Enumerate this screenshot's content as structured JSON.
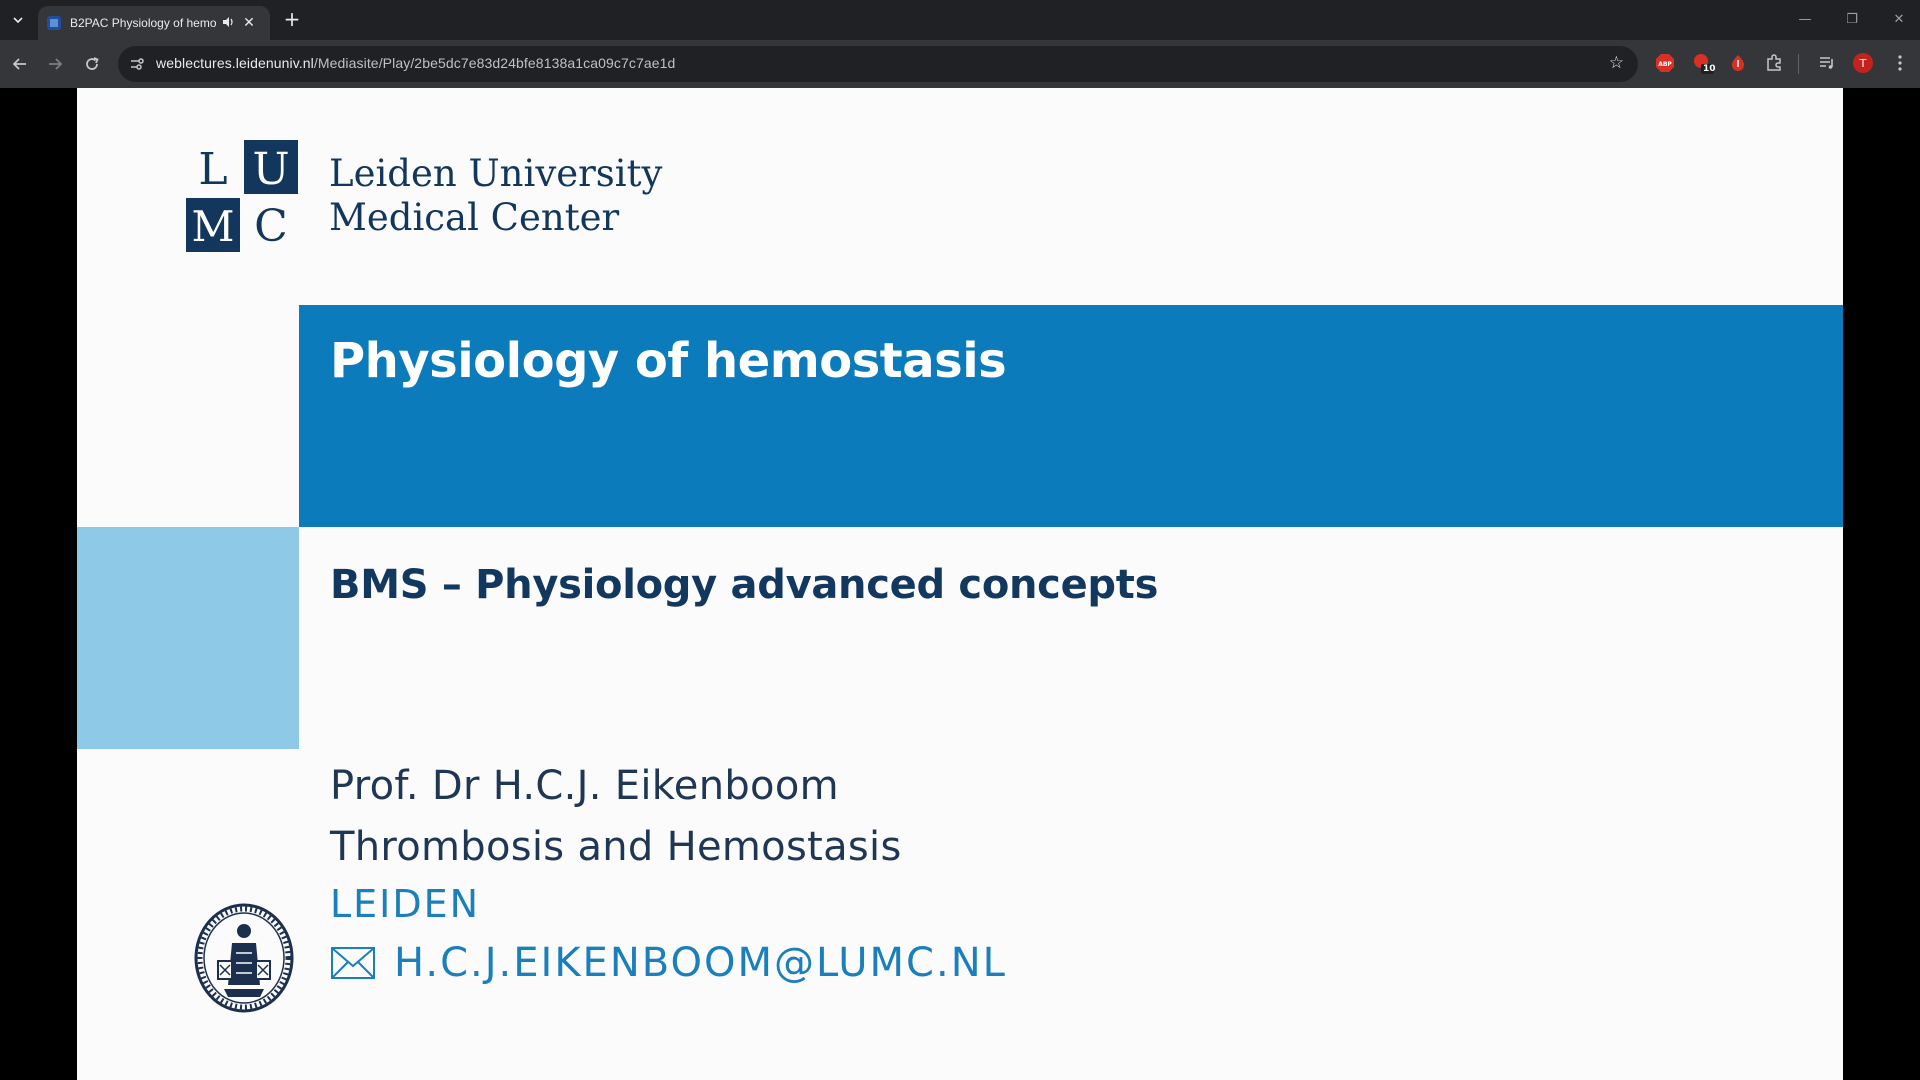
{
  "browser": {
    "tab_title": "B2PAC Physiology of hemo",
    "url_host": "weblectures.leidenuniv.nl",
    "url_path": "/Mediasite/Play/2be5dc7e83d24bfe8138a1ca09c7c7ae1d",
    "extensions": {
      "abp_label": "ABP",
      "badge_count": "10",
      "profile_initial": "T"
    }
  },
  "slide": {
    "logo": {
      "letters": [
        "L",
        "U",
        "M",
        "C"
      ],
      "line1": "Leiden University",
      "line2": "Medical Center"
    },
    "title": "Physiology of hemostasis",
    "subtitle": "BMS – Physiology advanced concepts",
    "presenter": "Prof. Dr H.C.J. Eikenboom",
    "department": "Thrombosis and Hemostasis",
    "city": "LEIDEN",
    "email": "H.C.J.EIKENBOOM@LUMC.NL",
    "colors": {
      "primary_blue": "#0b7bbb",
      "light_blue": "#8ecae8",
      "navy": "#13385f"
    }
  }
}
